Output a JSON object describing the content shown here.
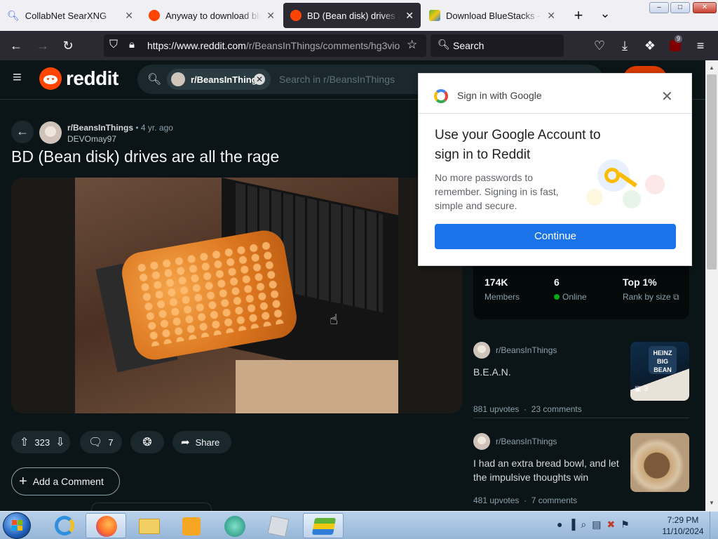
{
  "browser": {
    "tabs": [
      {
        "title": "CollabNet SearXNG",
        "favicon_color": "#3c6ee0"
      },
      {
        "title": "Anyway to download blueStacks",
        "favicon_color": "#ff4500"
      },
      {
        "title": "BD (Bean disk) drives are all the rage",
        "favicon_color": "#ff4500"
      },
      {
        "title": "Download BlueStacks - App Player",
        "favicon_color": "#5fb336"
      }
    ],
    "close_glyph": "✕",
    "new_tab_glyph": "+",
    "tab_list_glyph": "⌄",
    "url_host": "https://www.reddit.com",
    "url_path": "/r/BeansInThings/comments/hg3vio",
    "search_placeholder": "Search",
    "extension_badge": "9"
  },
  "reddit": {
    "logo_text": "reddit",
    "search_chip": "r/BeansInThings",
    "search_placeholder": "Search in r/BeansInThings",
    "post": {
      "subreddit": "r/BeansInThings",
      "age": "• 4 yr. ago",
      "author": "DEVOmay97",
      "title": "BD (Bean disk) drives are all the rage",
      "upvotes": "323",
      "comments": "7",
      "share_label": "Share",
      "add_comment_label": "Add a Comment"
    },
    "community": {
      "members_value": "174K",
      "members_label": "Members",
      "online_value": "6",
      "online_label": "Online",
      "rank_value": "Top 1%",
      "rank_label": "Rank by size"
    },
    "related": [
      {
        "subreddit": "r/BeansInThings",
        "title": "B.E.A.N.",
        "meta": "881 upvotes  ·  23 comments",
        "gallery_count": "3"
      },
      {
        "subreddit": "r/BeansInThings",
        "title": "I had an extra bread bowl, and let the impulsive thoughts win",
        "meta": "481 upvotes  ·  7 comments"
      }
    ]
  },
  "google_popup": {
    "header": "Sign in with Google",
    "heading": "Use your Google Account to sign in to Reddit",
    "body": "No more passwords to remember. Signing in is fast, simple and secure.",
    "continue_label": "Continue",
    "accent": "#1a73e8"
  },
  "taskbar": {
    "time": "7:29 PM",
    "date": "11/10/2024"
  }
}
